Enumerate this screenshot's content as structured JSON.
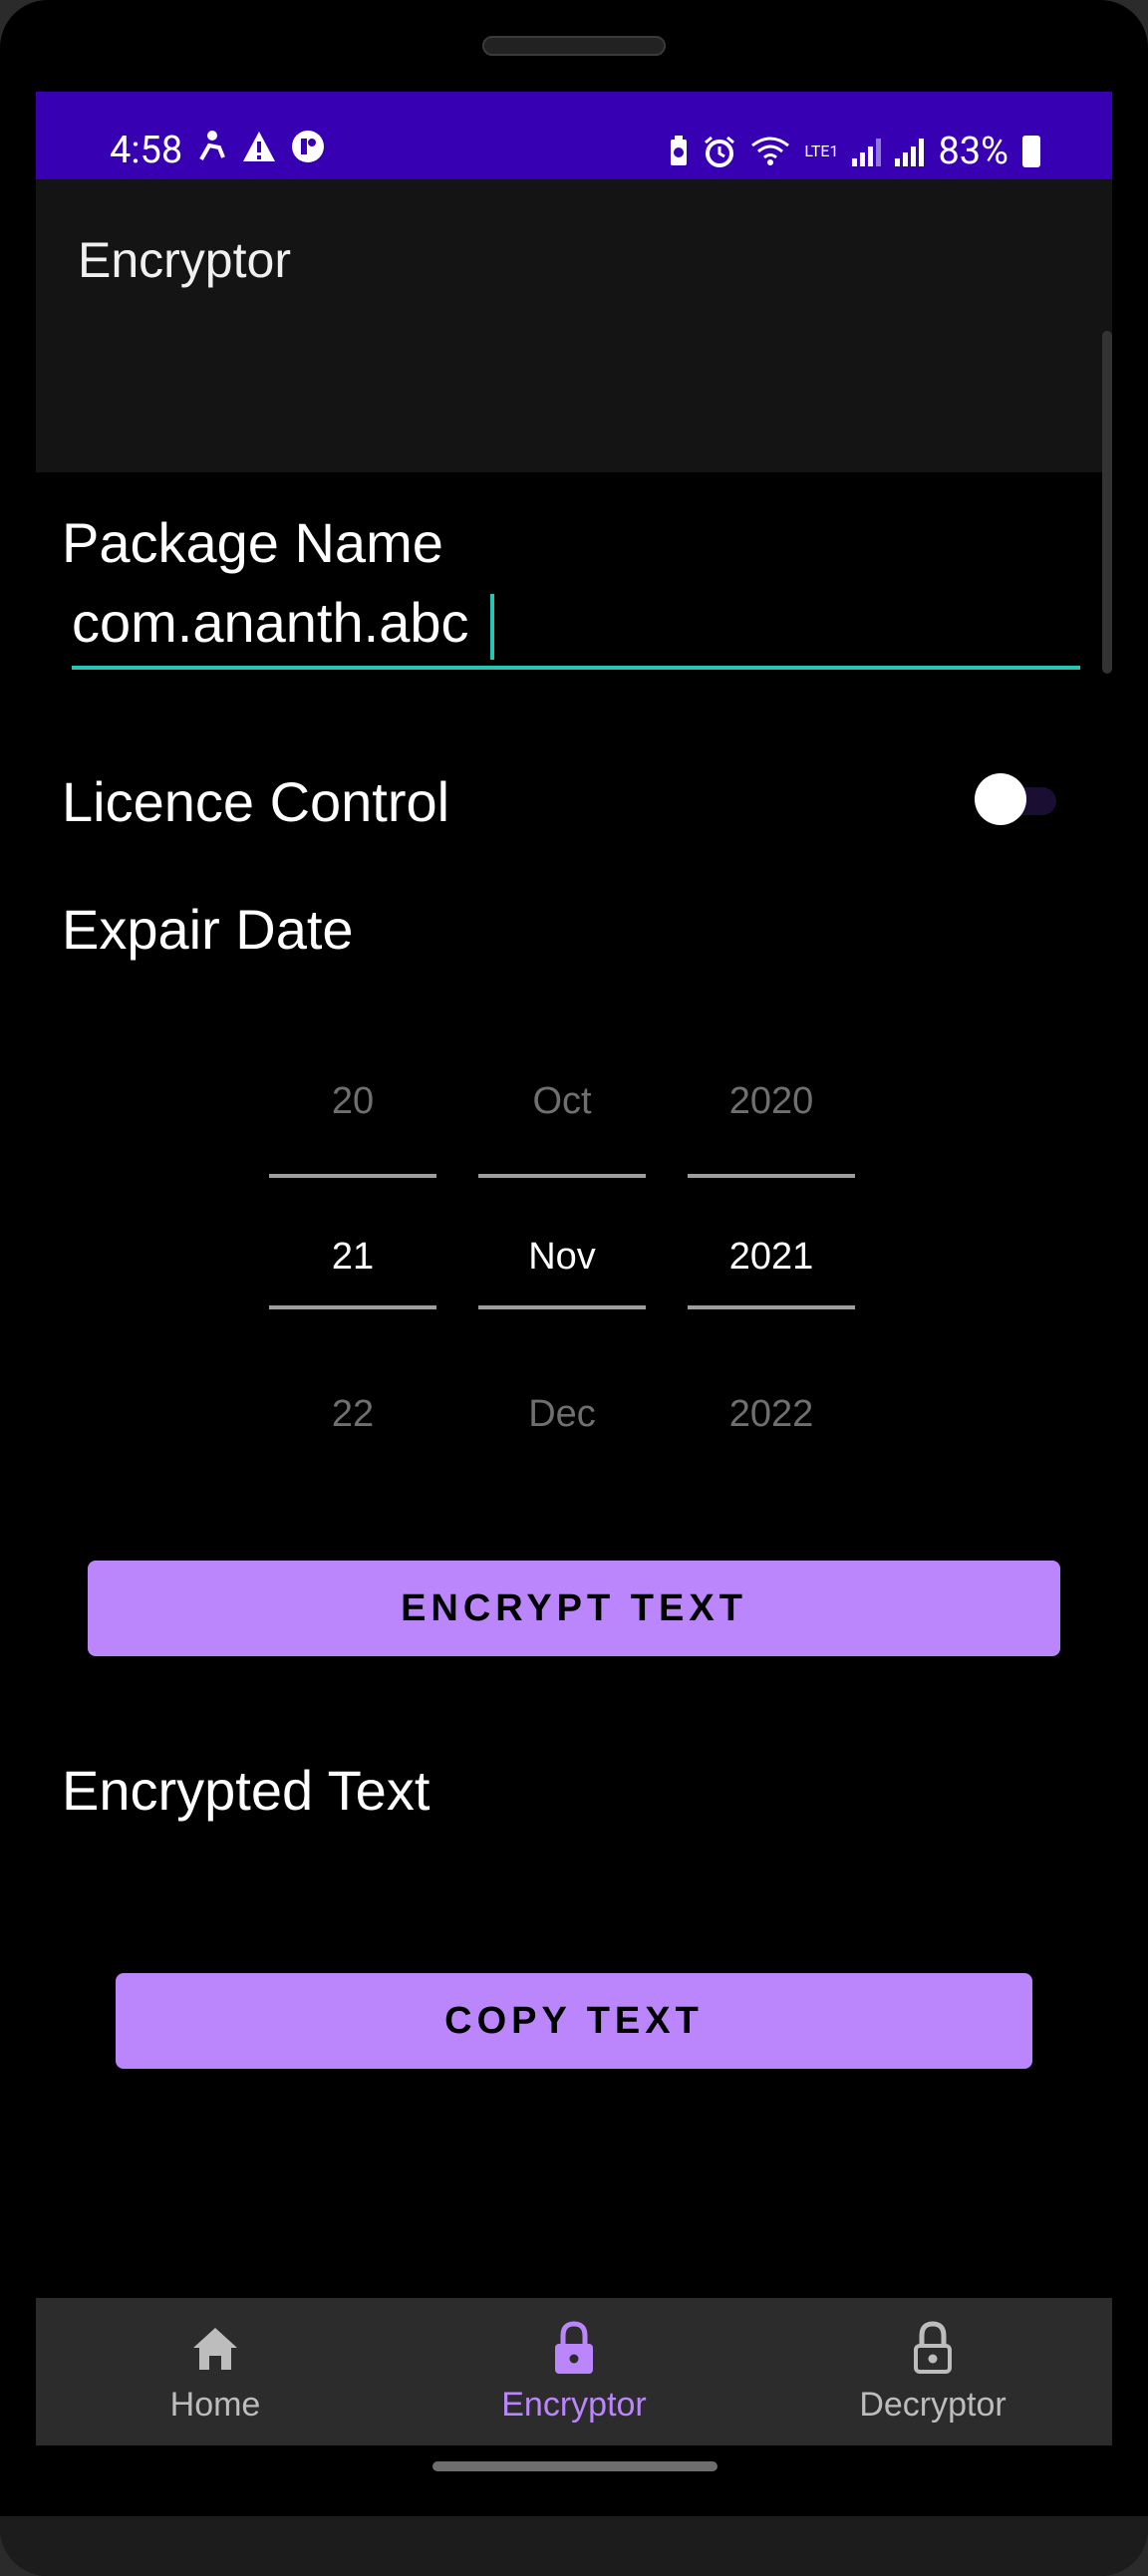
{
  "status_bar": {
    "time": "4:58",
    "battery_percent": "83%",
    "network_label": "LTE1",
    "left_icons": [
      "accessibility-icon",
      "warning-icon",
      "app-notification-icon"
    ],
    "right_icons": [
      "battery-saver-icon",
      "alarm-icon",
      "wifi-icon",
      "signal-1-icon",
      "signal-2-icon",
      "battery-icon"
    ],
    "color": "#3700b3"
  },
  "app_bar": {
    "title": "Encryptor",
    "color": "#141414"
  },
  "form": {
    "package_name_label": "Package Name",
    "package_name_value": "com.ananth.abc",
    "licence_control_label": "Licence Control",
    "licence_control_on": false,
    "expiry_date_label": "Expair Date",
    "accent_color": "#26c6b5"
  },
  "date_picker": {
    "day": {
      "prev": "20",
      "current": "21",
      "next": "22"
    },
    "month": {
      "prev": "Oct",
      "current": "Nov",
      "next": "Dec"
    },
    "year": {
      "prev": "2020",
      "current": "2021",
      "next": "2022"
    }
  },
  "actions": {
    "encrypt_label": "ENCRYPT TEXT",
    "copy_label": "COPY TEXT",
    "button_color": "#bb86fc"
  },
  "output": {
    "encrypted_text_label": "Encrypted Text",
    "encrypted_text_value": ""
  },
  "bottom_nav": {
    "items": [
      {
        "label": "Home",
        "icon": "home-icon",
        "selected": false
      },
      {
        "label": "Encryptor",
        "icon": "lock-closed-icon",
        "selected": true
      },
      {
        "label": "Decryptor",
        "icon": "lock-open-icon",
        "selected": false
      }
    ],
    "selected_color": "#bb86fc",
    "unselected_color": "#bdbdbd"
  }
}
